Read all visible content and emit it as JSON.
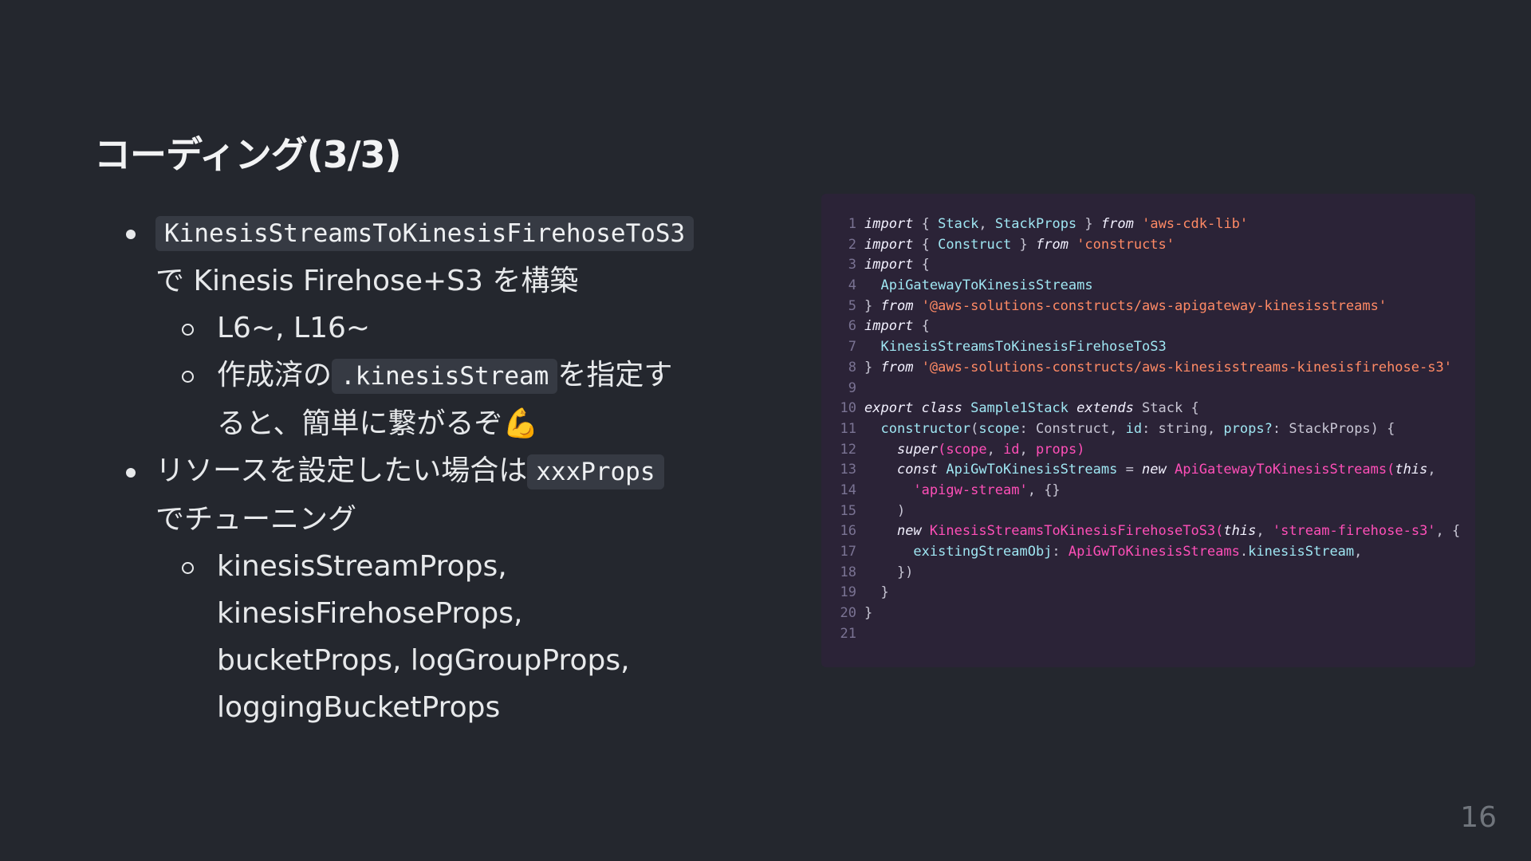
{
  "title": "コーディング(3/3)",
  "bullets": {
    "b1_code": "KinesisStreamsToKinesisFirehoseToS3",
    "b1_text": "で Kinesis Firehose+S3 を構築",
    "b1_sub1": "L6~, L16~",
    "b1_sub2_prefix": "作成済の",
    "b1_sub2_code": ".kinesisStream",
    "b1_sub2_suffix": "を指定すると、簡単に繋がるぞ",
    "b1_sub2_emoji": "💪",
    "b2_prefix": "リソースを設定したい場合は",
    "b2_code": "xxxProps",
    "b2_suffix": "でチューニング",
    "b2_sub1_lines": [
      "kinesisStreamProps,",
      "kinesisFirehoseProps,",
      "bucketProps, logGroupProps,",
      "loggingBucketProps"
    ]
  },
  "code": {
    "line_numbers": [
      "1",
      "2",
      "3",
      "4",
      "5",
      "6",
      "7",
      "8",
      "9",
      "10",
      "11",
      "12",
      "13",
      "14",
      "15",
      "16",
      "17",
      "18",
      "19",
      "20",
      "21"
    ],
    "l1": [
      "import",
      " { ",
      "Stack",
      ", ",
      "StackProps",
      " } ",
      "from",
      " ",
      "'aws-cdk-lib'"
    ],
    "l2": [
      "import",
      " { ",
      "Construct",
      " } ",
      "from",
      " ",
      "'constructs'"
    ],
    "l3": [
      "import",
      " {"
    ],
    "l4": [
      "  ",
      "ApiGatewayToKinesisStreams"
    ],
    "l5": [
      "} ",
      "from",
      " ",
      "'@aws-solutions-constructs/aws-apigateway-kinesisstreams'"
    ],
    "l6": [
      "import",
      " {"
    ],
    "l7": [
      "  ",
      "KinesisStreamsToKinesisFirehoseToS3"
    ],
    "l8": [
      "} ",
      "from",
      " ",
      "'@aws-solutions-constructs/aws-kinesisstreams-kinesisfirehose-s3'"
    ],
    "l9": [
      ""
    ],
    "l10": [
      "export class",
      " ",
      "Sample1Stack",
      " ",
      "extends",
      " Stack {"
    ],
    "l11": [
      "  ",
      "constructor",
      "(",
      "scope",
      ": Construct, ",
      "id",
      ": string, ",
      "props?",
      ": StackProps) {"
    ],
    "l12": [
      "    ",
      "super",
      "(",
      "scope",
      ", ",
      "id",
      ", ",
      "props",
      ")"
    ],
    "l13": [
      "    ",
      "const",
      " ",
      "ApiGwToKinesisStreams",
      " = ",
      "new",
      " ",
      "ApiGatewayToKinesisStreams",
      "(",
      "this",
      ","
    ],
    "l14": [
      "      ",
      "'apigw-stream'",
      ", {}"
    ],
    "l15": [
      "    )"
    ],
    "l16": [
      "    ",
      "new",
      " ",
      "KinesisStreamsToKinesisFirehoseToS3",
      "(",
      "this",
      ", ",
      "'stream-firehose-s3'",
      ", {"
    ],
    "l17": [
      "      ",
      "existingStreamObj",
      ": ",
      "ApiGwToKinesisStreams",
      ".",
      "kinesisStream",
      ","
    ],
    "l18": [
      "    })"
    ],
    "l19": [
      "  }"
    ],
    "l20": [
      "}"
    ],
    "l21": [
      ""
    ]
  },
  "page_number": "16"
}
